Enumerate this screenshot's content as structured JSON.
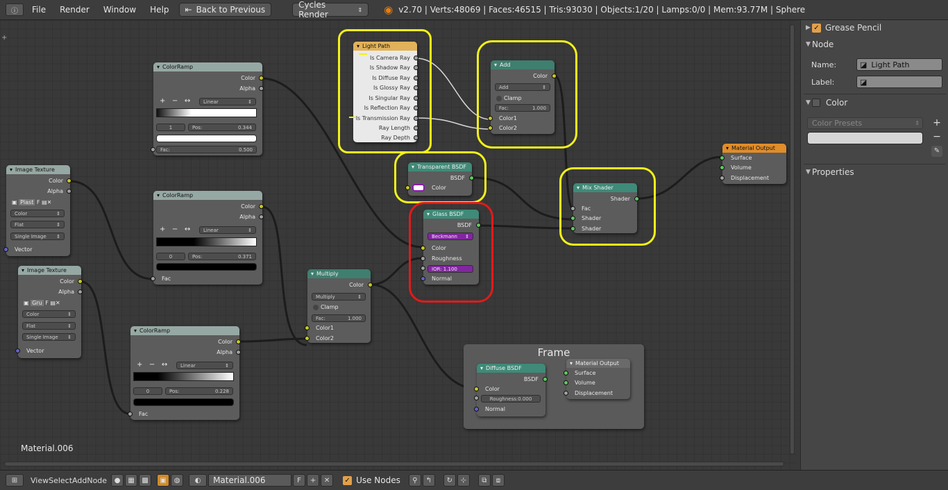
{
  "topbar": {
    "menus": [
      "File",
      "Render",
      "Window",
      "Help"
    ],
    "back_label": "Back to Previous",
    "engine": "Cycles Render",
    "stats": "v2.70 | Verts:48069 | Faces:46515 | Tris:93030 | Objects:1/20 | Lamps:0/0 | Mem:93.77M | Sphere"
  },
  "nodes": {
    "light_path": {
      "title": "Light Path",
      "outputs": [
        "Is Camera Ray",
        "Is Shadow Ray",
        "Is Diffuse Ray",
        "Is Glossy Ray",
        "Is Singular Ray",
        "Is Reflection Ray",
        "Is Transmission Ray",
        "Ray Length",
        "Ray Depth"
      ]
    },
    "add": {
      "title": "Add",
      "out": "Color",
      "mode": "Add",
      "clamp": "Clamp",
      "fac": "Fac:",
      "fac_val": "1.000",
      "in1": "Color1",
      "in2": "Color2"
    },
    "colorramp1": {
      "title": "ColorRamp",
      "out1": "Color",
      "out2": "Alpha",
      "interp": "Linear",
      "index": "1",
      "pos": "Pos:",
      "pos_val": "0.344",
      "fac": "Fac:",
      "fac_val": "0.500"
    },
    "colorramp2": {
      "title": "ColorRamp",
      "out1": "Color",
      "out2": "Alpha",
      "interp": "Linear",
      "index": "0",
      "pos": "Pos:",
      "pos_val": "0.371",
      "fac": "Fac"
    },
    "colorramp3": {
      "title": "ColorRamp",
      "out1": "Color",
      "out2": "Alpha",
      "interp": "Linear",
      "index": "0",
      "pos": "Pos:",
      "pos_val": "0.228",
      "fac": "Fac"
    },
    "imgtex1": {
      "title": "Image Texture",
      "out1": "Color",
      "out2": "Alpha",
      "image": "Plast",
      "f": "F",
      "color": "Color",
      "proj": "Flat",
      "src": "Single Image",
      "vec": "Vector"
    },
    "imgtex2": {
      "title": "Image Texture",
      "out1": "Color",
      "out2": "Alpha",
      "image": "Gru",
      "f": "F",
      "color": "Color",
      "proj": "Flat",
      "src": "Single Image",
      "vec": "Vector"
    },
    "transparent": {
      "title": "Transparent BSDF",
      "out": "BSDF",
      "in": "Color"
    },
    "glass": {
      "title": "Glass BSDF",
      "out": "BSDF",
      "dist": "Beckmann",
      "color": "Color",
      "rough": "Roughness",
      "ior": "IOR:  1.100",
      "normal": "Normal"
    },
    "multiply": {
      "title": "Multiply",
      "out": "Color",
      "mode": "Multiply",
      "clamp": "Clamp",
      "fac": "Fac:",
      "fac_val": "1.000",
      "in1": "Color1",
      "in2": "Color2"
    },
    "mix": {
      "title": "Mix Shader",
      "out": "Shader",
      "fac": "Fac",
      "s1": "Shader",
      "s2": "Shader"
    },
    "matout": {
      "title": "Material Output",
      "surface": "Surface",
      "volume": "Volume",
      "disp": "Displacement"
    },
    "frame": {
      "title": "Frame"
    },
    "diffuse": {
      "title": "Diffuse BSDF",
      "out": "BSDF",
      "color": "Color",
      "rough": "Roughness:0.000",
      "normal": "Normal"
    },
    "matout2": {
      "title": "Material Output",
      "surface": "Surface",
      "volume": "Volume",
      "disp": "Displacement"
    }
  },
  "editor": {
    "material_label": "Material.006"
  },
  "panel": {
    "grease": "Grease Pencil",
    "node": "Node",
    "name_label": "Name:",
    "name_val": "Light Path",
    "label_label": "Label:",
    "color": "Color",
    "presets": "Color Presets",
    "properties": "Properties"
  },
  "bottombar": {
    "menus": [
      "View",
      "Select",
      "Add",
      "Node"
    ],
    "material": "Material.006",
    "f": "F",
    "use_nodes": "Use Nodes"
  },
  "colors": {
    "highlight": "#f2f21a",
    "red_highlight": "#e21a1a"
  }
}
